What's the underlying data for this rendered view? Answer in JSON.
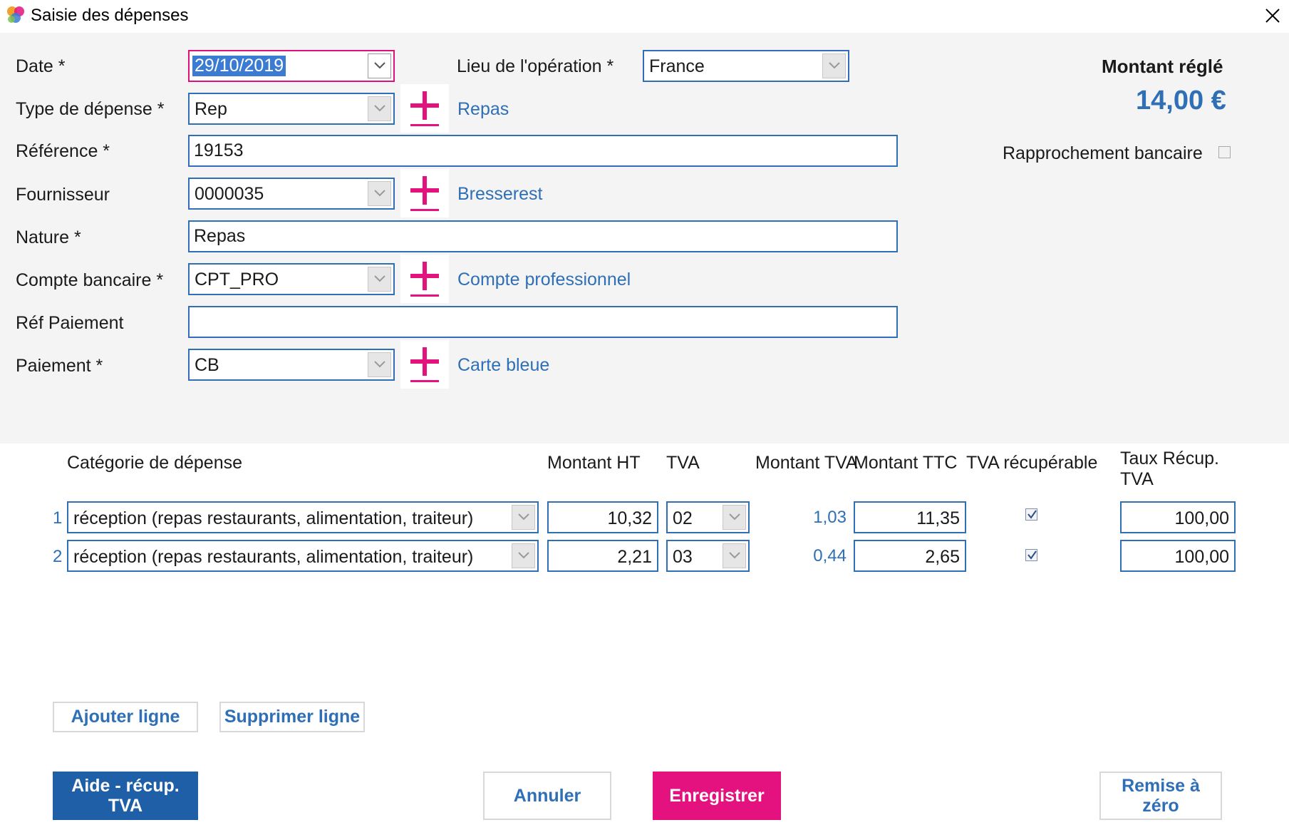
{
  "window": {
    "title": "Saisie des dépenses",
    "close_icon": "close-icon"
  },
  "form": {
    "date": {
      "label": "Date *",
      "value": "29/10/2019"
    },
    "lieu": {
      "label": "Lieu de l'opération *",
      "value": "France"
    },
    "type_depense": {
      "label": "Type de dépense *",
      "value": "Rep",
      "link": "Repas"
    },
    "reference": {
      "label": "Référence *",
      "value": "19153"
    },
    "fournisseur": {
      "label": "Fournisseur",
      "value": "0000035",
      "link": "Bresserest"
    },
    "nature": {
      "label": "Nature *",
      "value": "Repas"
    },
    "compte_bancaire": {
      "label": "Compte bancaire *",
      "value": "CPT_PRO",
      "link": "Compte professionnel"
    },
    "ref_paiement": {
      "label": "Réf Paiement",
      "value": ""
    },
    "paiement": {
      "label": "Paiement *",
      "value": "CB",
      "link": "Carte bleue"
    }
  },
  "summary": {
    "title": "Montant réglé",
    "amount": "14,00 €",
    "rapprochement_label": "Rapprochement bancaire",
    "rapprochement_checked": false
  },
  "table": {
    "headers": {
      "categorie": "Catégorie de dépense",
      "montant_ht": "Montant HT",
      "tva": "TVA",
      "montant_tva": "Montant TVA",
      "montant_ttc": "Montant TTC",
      "tva_recup": "TVA récupérable",
      "taux_line1": "Taux Récup.",
      "taux_line2": "TVA"
    },
    "rows": [
      {
        "num": "1",
        "categorie": "réception (repas restaurants, alimentation, traiteur)",
        "montant_ht": "10,32",
        "tva": "02",
        "montant_tva": "1,03",
        "montant_ttc": "11,35",
        "tva_recup": true,
        "taux": "100,00"
      },
      {
        "num": "2",
        "categorie": "réception (repas restaurants, alimentation, traiteur)",
        "montant_ht": "2,21",
        "tva": "03",
        "montant_tva": "0,44",
        "montant_ttc": "2,65",
        "tva_recup": true,
        "taux": "100,00"
      }
    ]
  },
  "buttons": {
    "ajouter": "Ajouter ligne",
    "supprimer": "Supprimer ligne",
    "aide_line1": "Aide - récup.",
    "aide_line2": "TVA",
    "annuler": "Annuler",
    "enregistrer": "Enregistrer",
    "remise_line1": "Remise à",
    "remise_line2": "zéro"
  },
  "colors": {
    "accent_blue": "#2e6fb5",
    "accent_pink": "#e3127e",
    "primary_blue": "#1f5fa8"
  }
}
